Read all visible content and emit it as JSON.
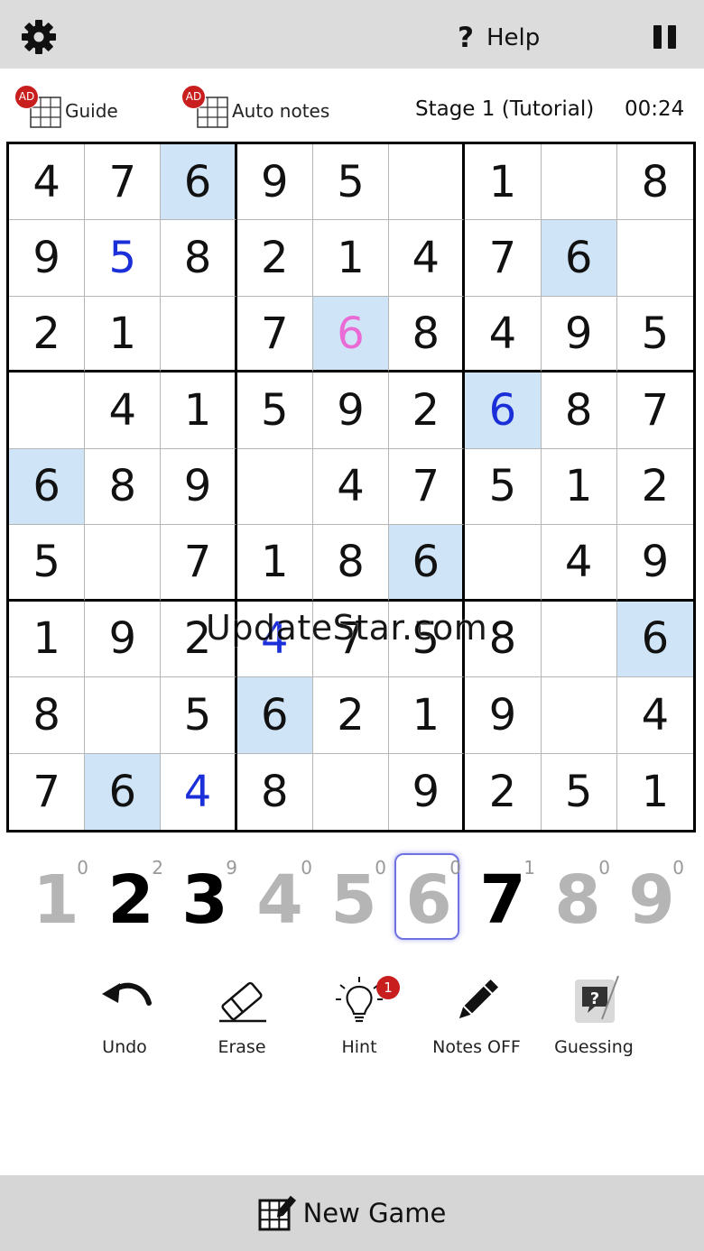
{
  "header": {
    "settings_icon": "gear-icon",
    "help_mark": "?",
    "help_label": "Help",
    "pause_icon": "pause-icon"
  },
  "info": {
    "guide_badge": "AD",
    "guide_label": "Guide",
    "autonotes_badge": "AD",
    "autonotes_label": "Auto notes",
    "stage": "Stage 1 (Tutorial)",
    "timer": "00:24"
  },
  "board": {
    "rows": [
      [
        "4",
        "7",
        "6",
        "9",
        "5",
        "",
        "1",
        "",
        "8"
      ],
      [
        "9",
        "5",
        "8",
        "2",
        "1",
        "4",
        "7",
        "6",
        ""
      ],
      [
        "2",
        "1",
        "",
        "7",
        "6",
        "8",
        "4",
        "9",
        "5"
      ],
      [
        "",
        "4",
        "1",
        "5",
        "9",
        "2",
        "6",
        "8",
        "7"
      ],
      [
        "6",
        "8",
        "9",
        "",
        "4",
        "7",
        "5",
        "1",
        "2"
      ],
      [
        "5",
        "",
        "7",
        "1",
        "8",
        "6",
        "",
        "4",
        "9"
      ],
      [
        "1",
        "9",
        "2",
        "4",
        "7",
        "5",
        "8",
        "",
        "6"
      ],
      [
        "8",
        "",
        "5",
        "6",
        "2",
        "1",
        "9",
        "",
        "4"
      ],
      [
        "7",
        "6",
        "4",
        "8",
        "",
        "9",
        "2",
        "5",
        "1"
      ]
    ],
    "highlighted": [
      [
        0,
        2
      ],
      [
        1,
        7
      ],
      [
        2,
        4
      ],
      [
        3,
        6
      ],
      [
        4,
        0
      ],
      [
        5,
        5
      ],
      [
        6,
        8
      ],
      [
        7,
        3
      ],
      [
        8,
        1
      ]
    ],
    "user_entered": [
      [
        1,
        1
      ],
      [
        3,
        6
      ],
      [
        6,
        3
      ],
      [
        8,
        2
      ]
    ],
    "pink": [
      [
        2,
        4
      ]
    ],
    "colors": {
      "highlight": "#cfe5f7",
      "user": "#1b2fd8",
      "pink": "#ea6ad6"
    }
  },
  "watermark": "UpdateStar.com",
  "numpad": [
    {
      "digit": "1",
      "count": "0",
      "active": false
    },
    {
      "digit": "2",
      "count": "2",
      "active": true
    },
    {
      "digit": "3",
      "count": "9",
      "active": true
    },
    {
      "digit": "4",
      "count": "0",
      "active": false
    },
    {
      "digit": "5",
      "count": "0",
      "active": false
    },
    {
      "digit": "6",
      "count": "0",
      "active": false,
      "selected": true
    },
    {
      "digit": "7",
      "count": "1",
      "active": true
    },
    {
      "digit": "8",
      "count": "0",
      "active": false
    },
    {
      "digit": "9",
      "count": "0",
      "active": false
    }
  ],
  "actions": {
    "undo_label": "Undo",
    "erase_label": "Erase",
    "hint_label": "Hint",
    "hint_badge": "1",
    "notes_label": "Notes OFF",
    "guessing_label": "Guessing",
    "guessing_mark": "?"
  },
  "footer": {
    "new_game_label": "New Game"
  }
}
